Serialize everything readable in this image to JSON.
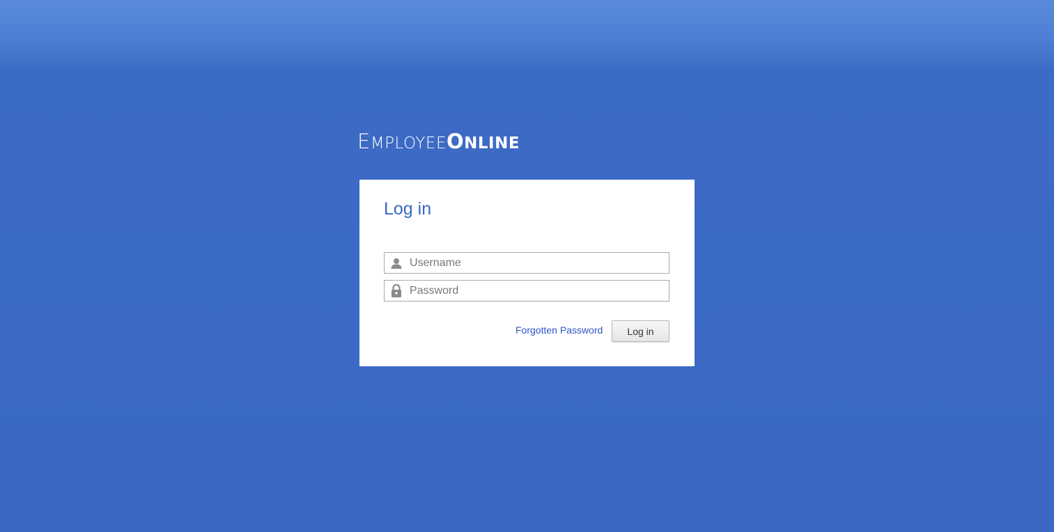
{
  "logo": {
    "part1_first": "E",
    "part1_rest": "MPLOYEE",
    "part2_first": "O",
    "part2_rest": "NLINE"
  },
  "login_card": {
    "title": "Log in",
    "username": {
      "placeholder": "Username",
      "value": "",
      "icon": "user-icon"
    },
    "password": {
      "placeholder": "Password",
      "value": "",
      "icon": "lock-icon"
    },
    "forgot_link": "Forgotten Password",
    "submit_label": "Log in"
  },
  "colors": {
    "background": "#3a68c3",
    "background_top": "#5a8ad9",
    "card": "#ffffff",
    "title": "#3a68c3",
    "link": "#2f56c6",
    "icon": "#8a8a8a"
  }
}
